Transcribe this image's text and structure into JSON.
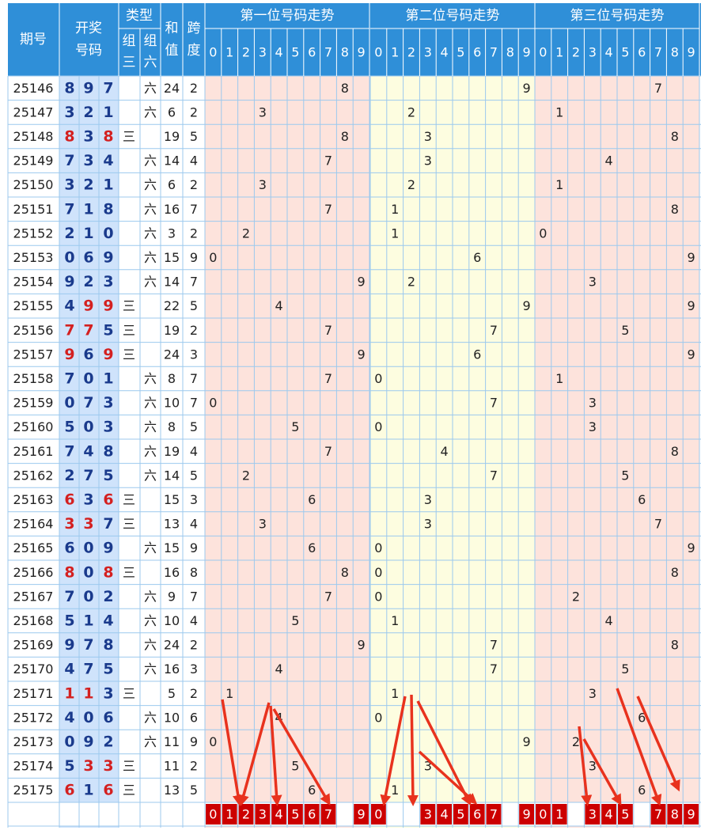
{
  "header": {
    "period": "期号",
    "award_line1": "开奖",
    "award_line2": "号码",
    "type": "类型",
    "type_g3_line1": "组",
    "type_g3_line2": "三",
    "type_g6_line1": "组",
    "type_g6_line2": "六",
    "sum_line1": "和",
    "sum_line2": "值",
    "span_line1": "跨",
    "span_line2": "度",
    "pos1_title": "第一位号码走势",
    "pos2_title": "第二位号码走势",
    "pos3_title": "第三位号码走势",
    "digits": [
      "0",
      "1",
      "2",
      "3",
      "4",
      "5",
      "6",
      "7",
      "8",
      "9"
    ]
  },
  "chart_data": {
    "type": "table",
    "rows": [
      {
        "period": "25146",
        "digits": [
          8,
          9,
          7
        ],
        "type": "六",
        "sum": 24,
        "span": 2
      },
      {
        "period": "25147",
        "digits": [
          3,
          2,
          1
        ],
        "type": "六",
        "sum": 6,
        "span": 2
      },
      {
        "period": "25148",
        "digits": [
          8,
          3,
          8
        ],
        "type": "三",
        "sum": 19,
        "span": 5
      },
      {
        "period": "25149",
        "digits": [
          7,
          3,
          4
        ],
        "type": "六",
        "sum": 14,
        "span": 4
      },
      {
        "period": "25150",
        "digits": [
          3,
          2,
          1
        ],
        "type": "六",
        "sum": 6,
        "span": 2
      },
      {
        "period": "25151",
        "digits": [
          7,
          1,
          8
        ],
        "type": "六",
        "sum": 16,
        "span": 7
      },
      {
        "period": "25152",
        "digits": [
          2,
          1,
          0
        ],
        "type": "六",
        "sum": 3,
        "span": 2
      },
      {
        "period": "25153",
        "digits": [
          0,
          6,
          9
        ],
        "type": "六",
        "sum": 15,
        "span": 9
      },
      {
        "period": "25154",
        "digits": [
          9,
          2,
          3
        ],
        "type": "六",
        "sum": 14,
        "span": 7
      },
      {
        "period": "25155",
        "digits": [
          4,
          9,
          9
        ],
        "type": "三",
        "sum": 22,
        "span": 5
      },
      {
        "period": "25156",
        "digits": [
          7,
          7,
          5
        ],
        "type": "三",
        "sum": 19,
        "span": 2
      },
      {
        "period": "25157",
        "digits": [
          9,
          6,
          9
        ],
        "type": "三",
        "sum": 24,
        "span": 3
      },
      {
        "period": "25158",
        "digits": [
          7,
          0,
          1
        ],
        "type": "六",
        "sum": 8,
        "span": 7
      },
      {
        "period": "25159",
        "digits": [
          0,
          7,
          3
        ],
        "type": "六",
        "sum": 10,
        "span": 7
      },
      {
        "period": "25160",
        "digits": [
          5,
          0,
          3
        ],
        "type": "六",
        "sum": 8,
        "span": 5
      },
      {
        "period": "25161",
        "digits": [
          7,
          4,
          8
        ],
        "type": "六",
        "sum": 19,
        "span": 4
      },
      {
        "period": "25162",
        "digits": [
          2,
          7,
          5
        ],
        "type": "六",
        "sum": 14,
        "span": 5
      },
      {
        "period": "25163",
        "digits": [
          6,
          3,
          6
        ],
        "type": "三",
        "sum": 15,
        "span": 3
      },
      {
        "period": "25164",
        "digits": [
          3,
          3,
          7
        ],
        "type": "三",
        "sum": 13,
        "span": 4
      },
      {
        "period": "25165",
        "digits": [
          6,
          0,
          9
        ],
        "type": "六",
        "sum": 15,
        "span": 9
      },
      {
        "period": "25166",
        "digits": [
          8,
          0,
          8
        ],
        "type": "三",
        "sum": 16,
        "span": 8
      },
      {
        "period": "25167",
        "digits": [
          7,
          0,
          2
        ],
        "type": "六",
        "sum": 9,
        "span": 7
      },
      {
        "period": "25168",
        "digits": [
          5,
          1,
          4
        ],
        "type": "六",
        "sum": 10,
        "span": 4
      },
      {
        "period": "25169",
        "digits": [
          9,
          7,
          8
        ],
        "type": "六",
        "sum": 24,
        "span": 2
      },
      {
        "period": "25170",
        "digits": [
          4,
          7,
          5
        ],
        "type": "六",
        "sum": 16,
        "span": 3
      },
      {
        "period": "25171",
        "digits": [
          1,
          1,
          3
        ],
        "type": "三",
        "sum": 5,
        "span": 2
      },
      {
        "period": "25172",
        "digits": [
          4,
          0,
          6
        ],
        "type": "六",
        "sum": 10,
        "span": 6
      },
      {
        "period": "25173",
        "digits": [
          0,
          9,
          2
        ],
        "type": "六",
        "sum": 11,
        "span": 9
      },
      {
        "period": "25174",
        "digits": [
          5,
          3,
          3
        ],
        "type": "三",
        "sum": 11,
        "span": 2
      },
      {
        "period": "25175",
        "digits": [
          6,
          1,
          6
        ],
        "type": "三",
        "sum": 13,
        "span": 5
      }
    ],
    "predictions": [
      [
        0,
        1,
        2,
        3,
        4,
        5,
        6,
        7,
        9
      ],
      [
        0,
        3,
        4,
        5,
        6,
        7,
        9
      ],
      [
        0,
        1,
        3,
        4,
        5,
        7,
        8,
        9
      ]
    ]
  },
  "colors": {
    "header_bg": "#2f8fd8",
    "header_text": "#ffffff",
    "grid_line": "#9cc9ee",
    "period_bg": "#ffffff",
    "award_bg": "#cfe3fb",
    "pos1_bg": "#fde3dc",
    "pos2_bg": "#fdfde0",
    "pos3_bg": "#fde3dc",
    "blue_digit": "#1a3a8c",
    "red_digit": "#d42020",
    "prediction_bg": "#cc0000",
    "arrow": "#e8321e"
  }
}
